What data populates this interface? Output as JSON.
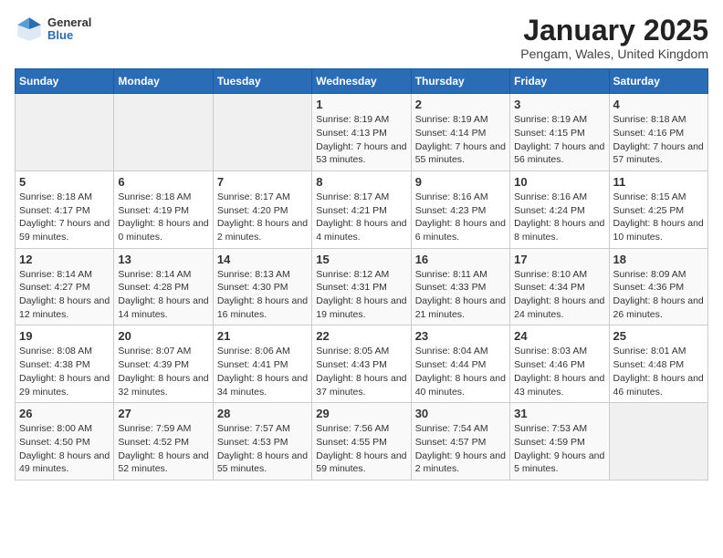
{
  "logo": {
    "general": "General",
    "blue": "Blue"
  },
  "title": "January 2025",
  "subtitle": "Pengam, Wales, United Kingdom",
  "weekdays": [
    "Sunday",
    "Monday",
    "Tuesday",
    "Wednesday",
    "Thursday",
    "Friday",
    "Saturday"
  ],
  "weeks": [
    [
      {
        "day": "",
        "sunrise": "",
        "sunset": "",
        "daylight": ""
      },
      {
        "day": "",
        "sunrise": "",
        "sunset": "",
        "daylight": ""
      },
      {
        "day": "",
        "sunrise": "",
        "sunset": "",
        "daylight": ""
      },
      {
        "day": "1",
        "sunrise": "Sunrise: 8:19 AM",
        "sunset": "Sunset: 4:13 PM",
        "daylight": "Daylight: 7 hours and 53 minutes."
      },
      {
        "day": "2",
        "sunrise": "Sunrise: 8:19 AM",
        "sunset": "Sunset: 4:14 PM",
        "daylight": "Daylight: 7 hours and 55 minutes."
      },
      {
        "day": "3",
        "sunrise": "Sunrise: 8:19 AM",
        "sunset": "Sunset: 4:15 PM",
        "daylight": "Daylight: 7 hours and 56 minutes."
      },
      {
        "day": "4",
        "sunrise": "Sunrise: 8:18 AM",
        "sunset": "Sunset: 4:16 PM",
        "daylight": "Daylight: 7 hours and 57 minutes."
      }
    ],
    [
      {
        "day": "5",
        "sunrise": "Sunrise: 8:18 AM",
        "sunset": "Sunset: 4:17 PM",
        "daylight": "Daylight: 7 hours and 59 minutes."
      },
      {
        "day": "6",
        "sunrise": "Sunrise: 8:18 AM",
        "sunset": "Sunset: 4:19 PM",
        "daylight": "Daylight: 8 hours and 0 minutes."
      },
      {
        "day": "7",
        "sunrise": "Sunrise: 8:17 AM",
        "sunset": "Sunset: 4:20 PM",
        "daylight": "Daylight: 8 hours and 2 minutes."
      },
      {
        "day": "8",
        "sunrise": "Sunrise: 8:17 AM",
        "sunset": "Sunset: 4:21 PM",
        "daylight": "Daylight: 8 hours and 4 minutes."
      },
      {
        "day": "9",
        "sunrise": "Sunrise: 8:16 AM",
        "sunset": "Sunset: 4:23 PM",
        "daylight": "Daylight: 8 hours and 6 minutes."
      },
      {
        "day": "10",
        "sunrise": "Sunrise: 8:16 AM",
        "sunset": "Sunset: 4:24 PM",
        "daylight": "Daylight: 8 hours and 8 minutes."
      },
      {
        "day": "11",
        "sunrise": "Sunrise: 8:15 AM",
        "sunset": "Sunset: 4:25 PM",
        "daylight": "Daylight: 8 hours and 10 minutes."
      }
    ],
    [
      {
        "day": "12",
        "sunrise": "Sunrise: 8:14 AM",
        "sunset": "Sunset: 4:27 PM",
        "daylight": "Daylight: 8 hours and 12 minutes."
      },
      {
        "day": "13",
        "sunrise": "Sunrise: 8:14 AM",
        "sunset": "Sunset: 4:28 PM",
        "daylight": "Daylight: 8 hours and 14 minutes."
      },
      {
        "day": "14",
        "sunrise": "Sunrise: 8:13 AM",
        "sunset": "Sunset: 4:30 PM",
        "daylight": "Daylight: 8 hours and 16 minutes."
      },
      {
        "day": "15",
        "sunrise": "Sunrise: 8:12 AM",
        "sunset": "Sunset: 4:31 PM",
        "daylight": "Daylight: 8 hours and 19 minutes."
      },
      {
        "day": "16",
        "sunrise": "Sunrise: 8:11 AM",
        "sunset": "Sunset: 4:33 PM",
        "daylight": "Daylight: 8 hours and 21 minutes."
      },
      {
        "day": "17",
        "sunrise": "Sunrise: 8:10 AM",
        "sunset": "Sunset: 4:34 PM",
        "daylight": "Daylight: 8 hours and 24 minutes."
      },
      {
        "day": "18",
        "sunrise": "Sunrise: 8:09 AM",
        "sunset": "Sunset: 4:36 PM",
        "daylight": "Daylight: 8 hours and 26 minutes."
      }
    ],
    [
      {
        "day": "19",
        "sunrise": "Sunrise: 8:08 AM",
        "sunset": "Sunset: 4:38 PM",
        "daylight": "Daylight: 8 hours and 29 minutes."
      },
      {
        "day": "20",
        "sunrise": "Sunrise: 8:07 AM",
        "sunset": "Sunset: 4:39 PM",
        "daylight": "Daylight: 8 hours and 32 minutes."
      },
      {
        "day": "21",
        "sunrise": "Sunrise: 8:06 AM",
        "sunset": "Sunset: 4:41 PM",
        "daylight": "Daylight: 8 hours and 34 minutes."
      },
      {
        "day": "22",
        "sunrise": "Sunrise: 8:05 AM",
        "sunset": "Sunset: 4:43 PM",
        "daylight": "Daylight: 8 hours and 37 minutes."
      },
      {
        "day": "23",
        "sunrise": "Sunrise: 8:04 AM",
        "sunset": "Sunset: 4:44 PM",
        "daylight": "Daylight: 8 hours and 40 minutes."
      },
      {
        "day": "24",
        "sunrise": "Sunrise: 8:03 AM",
        "sunset": "Sunset: 4:46 PM",
        "daylight": "Daylight: 8 hours and 43 minutes."
      },
      {
        "day": "25",
        "sunrise": "Sunrise: 8:01 AM",
        "sunset": "Sunset: 4:48 PM",
        "daylight": "Daylight: 8 hours and 46 minutes."
      }
    ],
    [
      {
        "day": "26",
        "sunrise": "Sunrise: 8:00 AM",
        "sunset": "Sunset: 4:50 PM",
        "daylight": "Daylight: 8 hours and 49 minutes."
      },
      {
        "day": "27",
        "sunrise": "Sunrise: 7:59 AM",
        "sunset": "Sunset: 4:52 PM",
        "daylight": "Daylight: 8 hours and 52 minutes."
      },
      {
        "day": "28",
        "sunrise": "Sunrise: 7:57 AM",
        "sunset": "Sunset: 4:53 PM",
        "daylight": "Daylight: 8 hours and 55 minutes."
      },
      {
        "day": "29",
        "sunrise": "Sunrise: 7:56 AM",
        "sunset": "Sunset: 4:55 PM",
        "daylight": "Daylight: 8 hours and 59 minutes."
      },
      {
        "day": "30",
        "sunrise": "Sunrise: 7:54 AM",
        "sunset": "Sunset: 4:57 PM",
        "daylight": "Daylight: 9 hours and 2 minutes."
      },
      {
        "day": "31",
        "sunrise": "Sunrise: 7:53 AM",
        "sunset": "Sunset: 4:59 PM",
        "daylight": "Daylight: 9 hours and 5 minutes."
      },
      {
        "day": "",
        "sunrise": "",
        "sunset": "",
        "daylight": ""
      }
    ]
  ]
}
